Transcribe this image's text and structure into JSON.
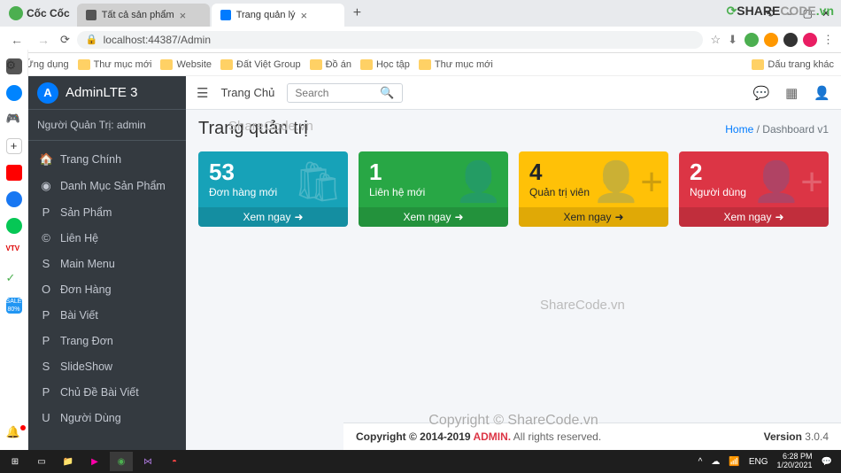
{
  "browser": {
    "brand": "Cốc Cốc",
    "tabs": [
      {
        "title": "Tất cả sản phẩm"
      },
      {
        "title": "Trang quản lý"
      }
    ],
    "url": "localhost:44387/Admin",
    "bookmarks": [
      "Ứng dụng",
      "Thư mục mới",
      "Website",
      "Đất Việt Group",
      "Đồ án",
      "Học tập",
      "Thư mục mới"
    ],
    "other_bookmarks": "Dấu trang khác",
    "win_min": "—",
    "win_max": "▢",
    "win_close": "✕",
    "restore": "⟲"
  },
  "sharecode": "SHARECODE.vn",
  "sidebar": {
    "brand": "AdminLTE 3",
    "user_label": "Người Quản Trị: admin",
    "items": [
      {
        "icon": "🏠",
        "label": "Trang Chính"
      },
      {
        "icon": "◉",
        "label": "Danh Mục Sản Phẩm"
      },
      {
        "icon": "P",
        "label": "Sản Phẩm"
      },
      {
        "icon": "©",
        "label": "Liên Hệ"
      },
      {
        "icon": "S",
        "label": "Main Menu"
      },
      {
        "icon": "O",
        "label": "Đơn Hàng"
      },
      {
        "icon": "P",
        "label": "Bài Viết"
      },
      {
        "icon": "P",
        "label": "Trang Đơn"
      },
      {
        "icon": "S",
        "label": "SlideShow"
      },
      {
        "icon": "P",
        "label": "Chủ Đề Bài Viết"
      },
      {
        "icon": "U",
        "label": "Người Dùng"
      }
    ]
  },
  "topbar": {
    "home": "Trang Chủ",
    "search_ph": "Search"
  },
  "header": {
    "title": "Trang quản trị",
    "crumb_home": "Home",
    "crumb_sep": " / ",
    "crumb_current": "Dashboard v1"
  },
  "cards": [
    {
      "num": "53",
      "label": "Đơn hàng mới",
      "link": "Xem ngay",
      "bgic": "🛍"
    },
    {
      "num": "1",
      "label": "Liên hệ mới",
      "link": "Xem ngay",
      "bgic": "👤"
    },
    {
      "num": "4",
      "label": "Quản trị viên",
      "link": "Xem ngay",
      "bgic": "👤+"
    },
    {
      "num": "2",
      "label": "Người dùng",
      "link": "Xem ngay",
      "bgic": "👤+"
    }
  ],
  "watermarks": {
    "w1": "ShareCode.vn",
    "w2": "ShareCode.vn",
    "cpy": "Copyright © ShareCode.vn"
  },
  "footer": {
    "copy_left": "Copyright © 2014-2019 ",
    "admin": "ADMIN.",
    "rights": " All rights reserved.",
    "ver_label": "Version ",
    "ver": "3.0.4"
  },
  "taskbar": {
    "lang": "ENG",
    "time": "6:28 PM",
    "date": "1/20/2021"
  }
}
